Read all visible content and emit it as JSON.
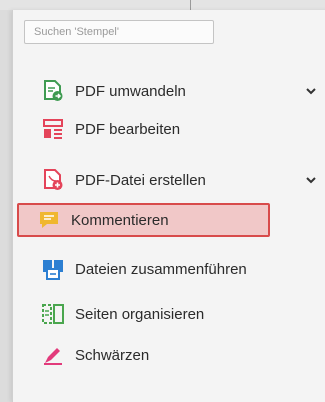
{
  "search": {
    "placeholder": "Suchen 'Stempel'"
  },
  "tools": [
    {
      "label": "PDF umwandeln",
      "icon": "pdf-convert-icon",
      "has_chevron": true
    },
    {
      "label": "PDF bearbeiten",
      "icon": "pdf-edit-icon",
      "has_chevron": false
    },
    {
      "label": "PDF-Datei erstellen",
      "icon": "pdf-create-icon",
      "has_chevron": true
    },
    {
      "label": "Kommentieren",
      "icon": "comment-icon",
      "has_chevron": false,
      "selected": true
    },
    {
      "label": "Dateien zusammenführen",
      "icon": "combine-files-icon",
      "has_chevron": false
    },
    {
      "label": "Seiten organisieren",
      "icon": "organize-pages-icon",
      "has_chevron": false
    },
    {
      "label": "Schwärzen",
      "icon": "redact-icon",
      "has_chevron": false
    }
  ],
  "colors": {
    "selection_border": "#d84b4b",
    "selection_fill": "#f1c8c8",
    "convert_green": "#3f9b52",
    "edit_red": "#e4445a",
    "create_red": "#e4445a",
    "comment_yellow": "#f0b72f",
    "combine_blue": "#2c7fd2",
    "organize_green": "#4aa64e",
    "redact_red": "#e23a7b"
  }
}
